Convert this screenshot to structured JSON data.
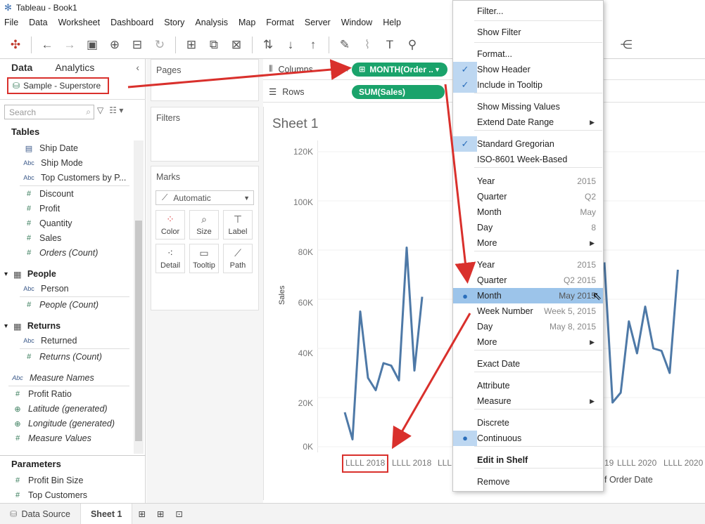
{
  "window": {
    "title": "Tableau - Book1"
  },
  "menubar": [
    "File",
    "Data",
    "Worksheet",
    "Dashboard",
    "Story",
    "Analysis",
    "Map",
    "Format",
    "Server",
    "Window",
    "Help"
  ],
  "data_pane": {
    "tab_data": "Data",
    "tab_analytics": "Analytics",
    "datasource": "Sample - Superstore",
    "search_placeholder": "Search",
    "tables_header": "Tables",
    "orders_fields": [
      "Ship Date",
      "Ship Mode",
      "Top Customers by P...",
      "Discount",
      "Profit",
      "Quantity",
      "Sales",
      "Orders (Count)"
    ],
    "people_header": "People",
    "people_fields": [
      "Person",
      "People (Count)"
    ],
    "returns_header": "Returns",
    "returns_fields": [
      "Returned",
      "Returns (Count)"
    ],
    "other_fields": [
      "Measure Names",
      "Profit Ratio",
      "Latitude (generated)",
      "Longitude (generated)",
      "Measure Values"
    ],
    "parameters_header": "Parameters",
    "parameters": [
      "Profit Bin Size",
      "Top Customers"
    ]
  },
  "cards": {
    "pages": "Pages",
    "filters": "Filters",
    "marks": "Marks",
    "marks_type": "Automatic",
    "mark_buttons": [
      "Color",
      "Size",
      "Label",
      "Detail",
      "Tooltip",
      "Path"
    ]
  },
  "shelves": {
    "columns_label": "Columns",
    "columns_pill": "MONTH(Order ..",
    "rows_label": "Rows",
    "rows_pill": "SUM(Sales)"
  },
  "view": {
    "sheet_title": "Sheet 1",
    "y_ticks": [
      "120K",
      "100K",
      "80K",
      "60K",
      "40K",
      "20K",
      "0K"
    ],
    "y_label": "Sales",
    "x_ticks_left": [
      "LLLL 2018",
      "LLLL 2018",
      "LLLL"
    ],
    "x_ticks_right": [
      "19",
      "LLLL 2020",
      "LLLL 2020"
    ],
    "x_title_fragment": "f Order Date"
  },
  "chart_data": {
    "type": "line",
    "ylabel": "Sales",
    "ylim": [
      0,
      120000
    ],
    "series": [
      {
        "values_left": [
          14000,
          3000,
          55000,
          28000,
          23000,
          34000,
          33000,
          27000,
          81000,
          31000,
          61000
        ]
      },
      {
        "values_right": [
          75000,
          18000,
          22000,
          51000,
          38000,
          57000,
          40000,
          39000,
          30000,
          72000
        ]
      }
    ]
  },
  "context_menu": {
    "items": [
      {
        "label": "Filter...",
        "check": "",
        "hint": ""
      },
      {
        "label": "Show Filter",
        "check": "",
        "hint": ""
      },
      {
        "label": "Format...",
        "check": "",
        "hint": ""
      },
      {
        "label": "Show Header",
        "check": "✓",
        "hint": ""
      },
      {
        "label": "Include in Tooltip",
        "check": "✓",
        "hint": ""
      },
      {
        "label": "Show Missing Values",
        "check": "",
        "hint": ""
      },
      {
        "label": "Extend Date Range",
        "check": "",
        "hint": "",
        "submenu": true
      },
      {
        "label": "Standard Gregorian",
        "check": "✓",
        "hint": ""
      },
      {
        "label": "ISO-8601 Week-Based",
        "check": "",
        "hint": ""
      },
      {
        "label": "Year",
        "check": "",
        "hint": "2015"
      },
      {
        "label": "Quarter",
        "check": "",
        "hint": "Q2"
      },
      {
        "label": "Month",
        "check": "",
        "hint": "May"
      },
      {
        "label": "Day",
        "check": "",
        "hint": "8"
      },
      {
        "label": "More",
        "check": "",
        "hint": "",
        "submenu": true
      },
      {
        "label": "Year",
        "check": "",
        "hint": "2015"
      },
      {
        "label": "Quarter",
        "check": "",
        "hint": "Q2 2015"
      },
      {
        "label": "Month",
        "check": "●",
        "hint": "May 2015",
        "highlight": true
      },
      {
        "label": "Week Number",
        "check": "",
        "hint": "Week 5, 2015"
      },
      {
        "label": "Day",
        "check": "",
        "hint": "May 8, 2015"
      },
      {
        "label": "More",
        "check": "",
        "hint": "",
        "submenu": true
      },
      {
        "label": "Exact Date",
        "check": "",
        "hint": ""
      },
      {
        "label": "Attribute",
        "check": "",
        "hint": ""
      },
      {
        "label": "Measure",
        "check": "",
        "hint": "",
        "submenu": true
      },
      {
        "label": "Discrete",
        "check": "",
        "hint": ""
      },
      {
        "label": "Continuous",
        "check": "●",
        "hint": ""
      },
      {
        "label": "Edit in Shelf",
        "check": "",
        "hint": "",
        "bold": true
      },
      {
        "label": "Remove",
        "check": "",
        "hint": ""
      }
    ]
  },
  "statusbar": {
    "datasource_tab": "Data Source",
    "sheet_tab": "Sheet 1"
  },
  "colors": {
    "accent": "#1aa36b",
    "line": "#4e79a7",
    "annotation": "#d9302c",
    "menu_highlight": "#9cc4ea"
  }
}
